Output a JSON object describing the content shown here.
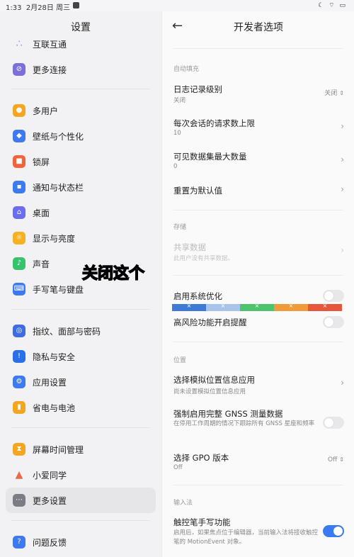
{
  "statusbar": {
    "time": "1:33",
    "date": "2月28日 周三",
    "right_icons": "☾ ⌔ ▭"
  },
  "sidebar": {
    "title": "设置",
    "items": [
      {
        "label": "互联互通",
        "icon": "connect-icon",
        "color": "#9b8df0"
      },
      {
        "label": "更多连接",
        "icon": "link-icon",
        "color": "#7b6fd9"
      },
      {
        "label": "多用户",
        "icon": "users-icon",
        "color": "#f4a623"
      },
      {
        "label": "壁纸与个性化",
        "icon": "palette-icon",
        "color": "#3d7af0"
      },
      {
        "label": "锁屏",
        "icon": "lock-icon",
        "color": "#f3633a"
      },
      {
        "label": "通知与状态栏",
        "icon": "notification-icon",
        "color": "#3d7af0"
      },
      {
        "label": "桌面",
        "icon": "home-icon",
        "color": "#6c6cf0"
      },
      {
        "label": "显示与亮度",
        "icon": "sun-icon",
        "color": "#f4b223"
      },
      {
        "label": "声音",
        "icon": "sound-icon",
        "color": "#36c36b"
      },
      {
        "label": "手写笔与键盘",
        "icon": "keyboard-icon",
        "color": "#3d7af0"
      },
      {
        "label": "指纹、面部与密码",
        "icon": "fingerprint-icon",
        "color": "#3d6de0"
      },
      {
        "label": "隐私与安全",
        "icon": "shield-icon",
        "color": "#2a6ee8"
      },
      {
        "label": "应用设置",
        "icon": "apps-icon",
        "color": "#3d7af0"
      },
      {
        "label": "省电与电池",
        "icon": "battery-icon",
        "color": "#f4a623"
      },
      {
        "label": "屏幕时间管理",
        "icon": "hourglass-icon",
        "color": "#f4a623"
      },
      {
        "label": "小爱同学",
        "icon": "assistant-icon",
        "color": "#e86a4a"
      },
      {
        "label": "更多设置",
        "icon": "more-icon",
        "color": "#7c7c86"
      },
      {
        "label": "问题反馈",
        "icon": "feedback-icon",
        "color": "#3d7af0"
      }
    ]
  },
  "main": {
    "title": "开发者选项",
    "autofill": {
      "header": "自动填充",
      "log_level_title": "日志记录级别",
      "log_level_sub": "关闭",
      "log_level_value": "关闭",
      "max_requests_title": "每次会话的请求数上限",
      "max_requests_value": "10",
      "max_datasets_title": "可见数据集最大数量",
      "max_datasets_value": "0",
      "reset_title": "重置为默认值"
    },
    "storage": {
      "header": "存储",
      "shared_title": "共享数据",
      "shared_sub": "此用户没有共享数据。"
    },
    "overlay_text": "关闭这个",
    "system_opt_title": "启用系统优化",
    "colorbar": {
      "colors": [
        "#3d7ad6",
        "#a8c4ea",
        "#4cc36c",
        "#f09a3a",
        "#e5563a"
      ],
      "mark": "×"
    },
    "high_risk_title": "高风险功能开启提醒",
    "location": {
      "header": "位置",
      "mock_title": "选择模拟位置信息应用",
      "mock_sub": "尚未设置模拟位置信息应用",
      "gnss_title": "强制启用完整 GNSS 测量数据",
      "gnss_sub": "在停用工作周期的情况下跟踪所有 GNSS 星座和频率",
      "gpo_title": "选择 GPO 版本",
      "gpo_sub": "Off",
      "gpo_value": "Off"
    },
    "input": {
      "header": "输入法",
      "stylus_title": "触控笔手写功能",
      "stylus_sub": "启用后，如果焦点位于编辑器，当前输入法将接收触控笔的 MotionEvent 对象。"
    }
  }
}
